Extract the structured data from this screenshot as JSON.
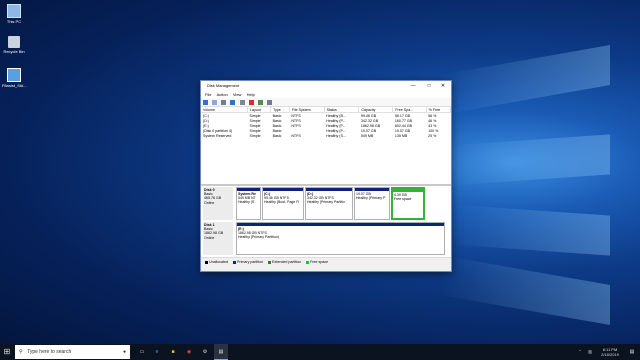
{
  "desktop": {
    "icons": [
      {
        "label": "This PC",
        "icon": "computer-icon"
      },
      {
        "label": "Recycle Bin",
        "icon": "recycle-bin-icon"
      },
      {
        "label": "PAssist_Std...",
        "icon": "app-icon"
      }
    ]
  },
  "window": {
    "title": "Disk Management",
    "menu": [
      "File",
      "Action",
      "View",
      "Help"
    ],
    "columns": [
      "Volume",
      "Layout",
      "Type",
      "File System",
      "Status",
      "Capacity",
      "Free Spa...",
      "% Free"
    ],
    "volumes": [
      {
        "volume": "(C:)",
        "layout": "Simple",
        "type": "Basic",
        "fs": "NTFS",
        "status": "Healthy (B...",
        "capacity": "99.46 GB",
        "free": "56.17 GB",
        "pct": "56 %"
      },
      {
        "volume": "(D:)",
        "layout": "Simple",
        "type": "Basic",
        "fs": "NTFS",
        "status": "Healthy (P...",
        "capacity": "342.32 GB",
        "free": "160.77 GB",
        "pct": "46 %"
      },
      {
        "volume": "(E:)",
        "layout": "Simple",
        "type": "Basic",
        "fs": "NTFS",
        "status": "Healthy (P...",
        "capacity": "1862.98 GB",
        "free": "802.44 GB",
        "pct": "43 %"
      },
      {
        "volume": "(Disk 0 partition 4)",
        "layout": "Simple",
        "type": "Basic",
        "fs": "",
        "status": "Healthy (P...",
        "capacity": "19.07 GB",
        "free": "19.07 GB",
        "pct": "100 %"
      },
      {
        "volume": "System Reserved",
        "layout": "Simple",
        "type": "Basic",
        "fs": "NTFS",
        "status": "Healthy (S...",
        "capacity": "549 MB",
        "free": "135 MB",
        "pct": "25 %"
      }
    ],
    "disk0": {
      "name": "Disk 0",
      "type": "Basic",
      "size": "465.76 GB",
      "state": "Online",
      "partitions": [
        {
          "name": "System Re",
          "size": "549 MB NT",
          "status": "Healthy (S",
          "color": "#0d2380"
        },
        {
          "name": "(C:)",
          "size": "99.46 GB NTFS",
          "status": "Healthy (Boot, Page Fi",
          "color": "#0d2380"
        },
        {
          "name": "(D:)",
          "size": "342.32 GB NTFS",
          "status": "Healthy (Primary Partitio",
          "color": "#0d2380"
        },
        {
          "name": "",
          "size": "19.07 GB",
          "status": "Healthy (Primary P",
          "color": "#0d2380"
        },
        {
          "name": "",
          "size": "4.39 GB",
          "status": "Free space",
          "color": "#34b233"
        }
      ]
    },
    "disk1": {
      "name": "Disk 1",
      "type": "Basic",
      "size": "1862.98 GB",
      "state": "Online",
      "partition": {
        "name": "(E:)",
        "size": "1862.98 GB NTFS",
        "status": "Healthy (Primary Partition)"
      }
    },
    "legend": [
      {
        "label": "Unallocated",
        "color": "#000000"
      },
      {
        "label": "Primary partition",
        "color": "#0d2380"
      },
      {
        "label": "Extended partition",
        "color": "#2e7d32"
      },
      {
        "label": "Free space",
        "color": "#34b233"
      }
    ]
  },
  "taskbar": {
    "search_placeholder": "Type here to search",
    "time": "8:11 PM",
    "date": "2/18/2019"
  }
}
